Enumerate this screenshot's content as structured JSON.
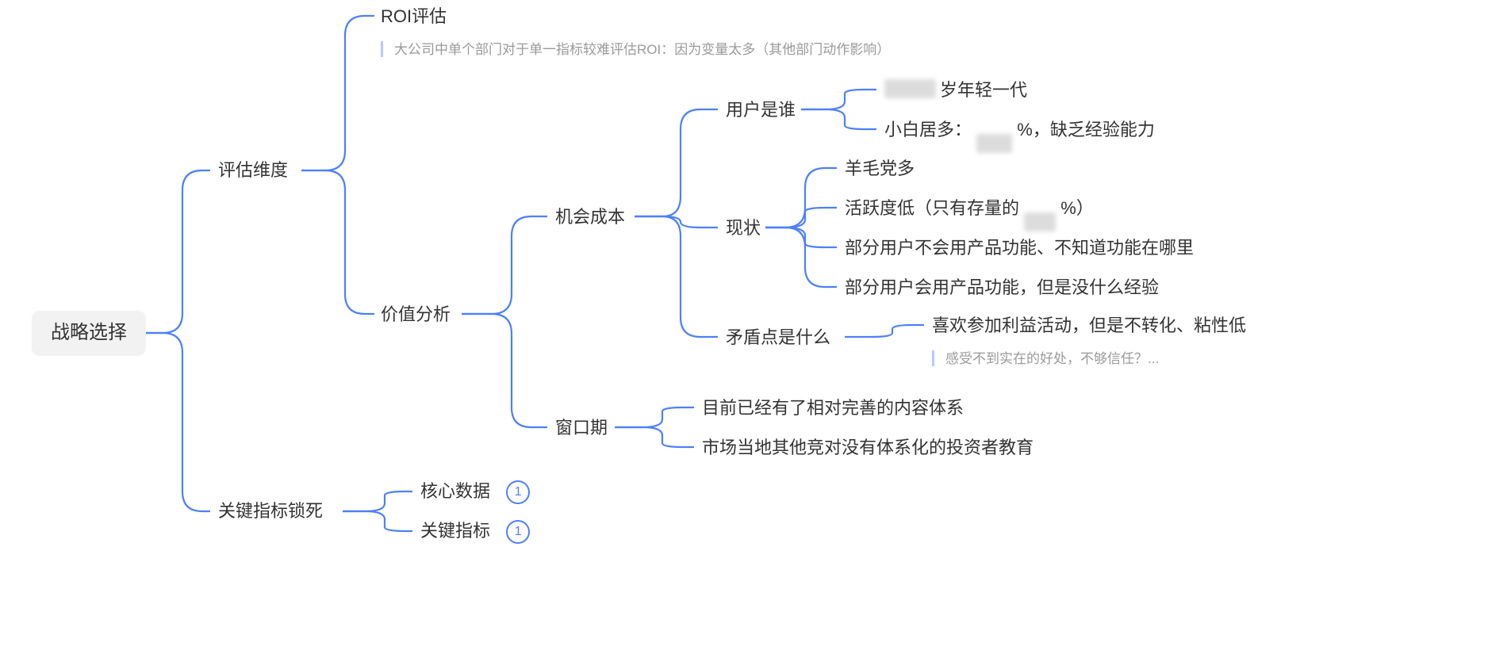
{
  "root": "战略选择",
  "l1": {
    "evalDim": "评估维度",
    "keyLock": "关键指标锁死"
  },
  "evalDim": {
    "roi": "ROI评估",
    "roiNote": "大公司中单个部门对于单一指标较难评估ROI：因为变量太多（其他部门动作影响）",
    "valueAnalysis": "价值分析"
  },
  "valueAnalysis": {
    "oppCost": "机会成本",
    "window": "窗口期"
  },
  "oppCost": {
    "whoUser": "用户是谁",
    "status": "现状",
    "contradiction": "矛盾点是什么"
  },
  "whoUser": {
    "a": "岁年轻一代",
    "b_prefix": "小白居多：",
    "b_suffix": "%，缺乏经验能力"
  },
  "status": {
    "a": "羊毛党多",
    "b_prefix": "活跃度低（只有存量的",
    "b_suffix": "%）",
    "c": "部分用户不会用产品功能、不知道功能在哪里",
    "d": "部分用户会用产品功能，但是没什么经验"
  },
  "contradiction": {
    "a": "喜欢参加利益活动，但是不转化、粘性低",
    "note": "感受不到实在的好处，不够信任？..."
  },
  "window": {
    "a": "目前已经有了相对完善的内容体系",
    "b": "市场当地其他竞对没有体系化的投资者教育"
  },
  "keyLock": {
    "coreData": "核心数据",
    "keyIndicator": "关键指标",
    "badge1": "1",
    "badge2": "1"
  }
}
